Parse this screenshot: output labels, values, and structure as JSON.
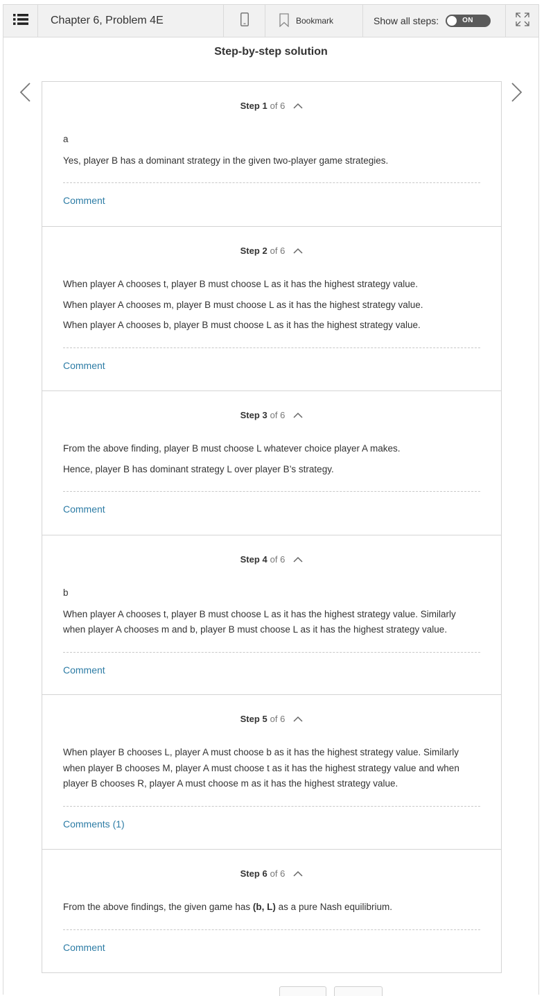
{
  "toolbar": {
    "title": "Chapter 6, Problem 4E",
    "bookmark_label": "Bookmark",
    "show_steps_label": "Show all steps:",
    "toggle_state": "ON"
  },
  "solution_title": "Step-by-step solution",
  "step_word": "Step",
  "of_text": "of 6",
  "steps": [
    {
      "num": "1",
      "paragraphs": [
        "a",
        "Yes, player B has a dominant strategy in the given two-player game strategies."
      ],
      "comment": "Comment"
    },
    {
      "num": "2",
      "paragraphs": [
        "When player A chooses t, player B must choose L as it has the highest strategy value.",
        "When player A chooses m, player B must choose L as it has the highest strategy value.",
        "When player A chooses b, player B must choose L as it has the highest strategy value."
      ],
      "comment": "Comment"
    },
    {
      "num": "3",
      "paragraphs": [
        "From the above finding, player B must choose L whatever choice player A makes.",
        "Hence, player B has dominant strategy L over player B’s strategy."
      ],
      "comment": "Comment"
    },
    {
      "num": "4",
      "paragraphs": [
        "b",
        "When player A chooses t, player B must choose L as it has the highest strategy value. Similarly when player A chooses m and b, player B must choose L as it has the highest strategy value."
      ],
      "comment": "Comment"
    },
    {
      "num": "5",
      "paragraphs": [
        "When player B chooses L, player A must choose b as it has the highest strategy value. Similarly when player B chooses M, player A must choose t as it has the highest strategy value and when player B chooses R, player A must choose m as it has the highest strategy value."
      ],
      "comment": "Comments (1)"
    },
    {
      "num": "6",
      "p_before": "From the above findings, the given game has ",
      "p_bold": "(b, L)",
      "p_after": " as a pure Nash equilibrium.",
      "comment": "Comment"
    }
  ]
}
